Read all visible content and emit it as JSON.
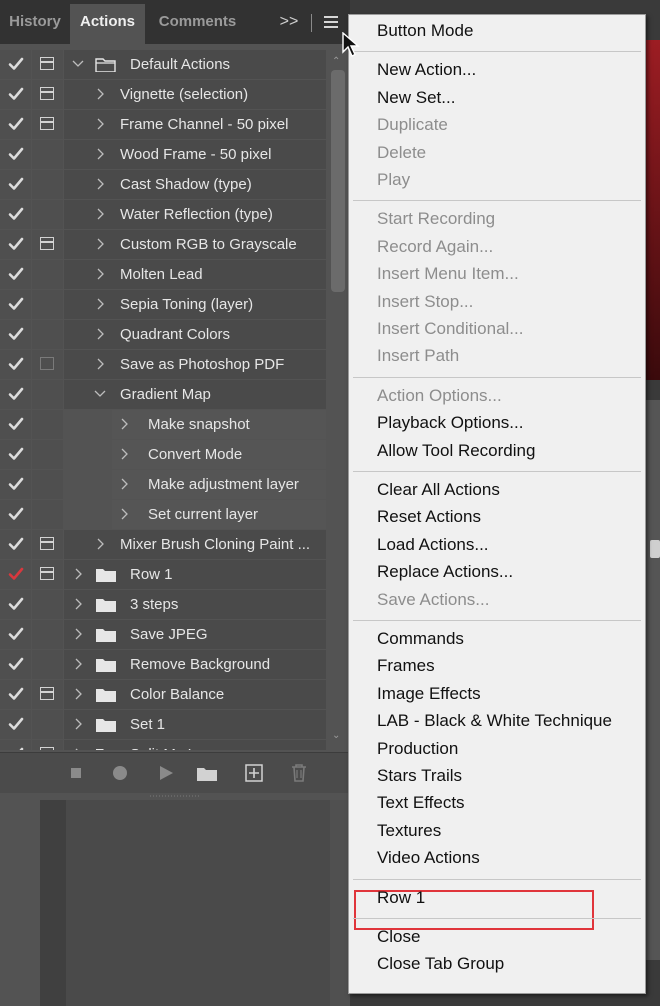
{
  "tabs": [
    {
      "label": "History",
      "active": false
    },
    {
      "label": "Actions",
      "active": true
    },
    {
      "label": "Comments",
      "active": false
    }
  ],
  "rows": [
    {
      "label": "Default Actions",
      "check_color": "#dcdcdc",
      "dialog": "box",
      "chevron": "down",
      "folder": "open",
      "indent": 0
    },
    {
      "label": "Vignette (selection)",
      "check_color": "#dcdcdc",
      "dialog": "box",
      "chevron": "right",
      "folder": "none",
      "indent": 1
    },
    {
      "label": "Frame Channel - 50 pixel",
      "check_color": "#dcdcdc",
      "dialog": "box",
      "chevron": "right",
      "folder": "none",
      "indent": 1
    },
    {
      "label": "Wood Frame - 50 pixel",
      "check_color": "#dcdcdc",
      "dialog": "none",
      "chevron": "right",
      "folder": "none",
      "indent": 1
    },
    {
      "label": "Cast Shadow (type)",
      "check_color": "#dcdcdc",
      "dialog": "none",
      "chevron": "right",
      "folder": "none",
      "indent": 1
    },
    {
      "label": "Water Reflection (type)",
      "check_color": "#dcdcdc",
      "dialog": "none",
      "chevron": "right",
      "folder": "none",
      "indent": 1
    },
    {
      "label": "Custom RGB to Grayscale",
      "check_color": "#dcdcdc",
      "dialog": "box",
      "chevron": "right",
      "folder": "none",
      "indent": 1
    },
    {
      "label": "Molten Lead",
      "check_color": "#dcdcdc",
      "dialog": "none",
      "chevron": "right",
      "folder": "none",
      "indent": 1
    },
    {
      "label": "Sepia Toning (layer)",
      "check_color": "#dcdcdc",
      "dialog": "none",
      "chevron": "right",
      "folder": "none",
      "indent": 1
    },
    {
      "label": "Quadrant Colors",
      "check_color": "#dcdcdc",
      "dialog": "none",
      "chevron": "right",
      "folder": "none",
      "indent": 1
    },
    {
      "label": "Save as Photoshop PDF",
      "check_color": "#dcdcdc",
      "dialog": "box-empty",
      "chevron": "right",
      "folder": "none",
      "indent": 1
    },
    {
      "label": "Gradient Map",
      "check_color": "#dcdcdc",
      "dialog": "none",
      "chevron": "down",
      "folder": "none",
      "indent": 1
    },
    {
      "label": "Make snapshot",
      "check_color": "#dcdcdc",
      "dialog": "none",
      "chevron": "right",
      "folder": "none",
      "indent": 2
    },
    {
      "label": "Convert Mode",
      "check_color": "#dcdcdc",
      "dialog": "none",
      "chevron": "right",
      "folder": "none",
      "indent": 2
    },
    {
      "label": "Make adjustment layer",
      "check_color": "#dcdcdc",
      "dialog": "none",
      "chevron": "right",
      "folder": "none",
      "indent": 2
    },
    {
      "label": "Set current layer",
      "check_color": "#dcdcdc",
      "dialog": "none",
      "chevron": "right",
      "folder": "none",
      "indent": 2
    },
    {
      "label": "Mixer Brush Cloning Paint ...",
      "check_color": "#dcdcdc",
      "dialog": "box",
      "chevron": "right",
      "folder": "none",
      "indent": 1
    },
    {
      "label": "Row 1",
      "check_color": "#d8383e",
      "dialog": "box",
      "chevron": "right",
      "folder": "closed",
      "indent": 0
    },
    {
      "label": "3 steps",
      "check_color": "#dcdcdc",
      "dialog": "none",
      "chevron": "right",
      "folder": "closed",
      "indent": 0
    },
    {
      "label": "Save JPEG",
      "check_color": "#dcdcdc",
      "dialog": "none",
      "chevron": "right",
      "folder": "closed",
      "indent": 0
    },
    {
      "label": "Remove Background",
      "check_color": "#dcdcdc",
      "dialog": "none",
      "chevron": "right",
      "folder": "closed",
      "indent": 0
    },
    {
      "label": "Color Balance",
      "check_color": "#dcdcdc",
      "dialog": "box",
      "chevron": "right",
      "folder": "closed",
      "indent": 0
    },
    {
      "label": "Set 1",
      "check_color": "#dcdcdc",
      "dialog": "none",
      "chevron": "right",
      "folder": "closed",
      "indent": 0
    },
    {
      "label": "Split My I...",
      "check_color": "#dcdcdc",
      "dialog": "box",
      "chevron": "right",
      "folder": "closed",
      "indent": 0
    }
  ],
  "bottom_icons": [
    "stop-icon",
    "record-icon",
    "play-icon",
    "new-set-icon",
    "new-action-icon",
    "trash-icon"
  ],
  "menu_groups": [
    [
      {
        "label": "Button Mode",
        "enabled": true
      }
    ],
    [
      {
        "label": "New Action...",
        "enabled": true
      },
      {
        "label": "New Set...",
        "enabled": true
      },
      {
        "label": "Duplicate",
        "enabled": false
      },
      {
        "label": "Delete",
        "enabled": false
      },
      {
        "label": "Play",
        "enabled": false
      }
    ],
    [
      {
        "label": "Start Recording",
        "enabled": false
      },
      {
        "label": "Record Again...",
        "enabled": false
      },
      {
        "label": "Insert Menu Item...",
        "enabled": false
      },
      {
        "label": "Insert Stop...",
        "enabled": false
      },
      {
        "label": "Insert Conditional...",
        "enabled": false
      },
      {
        "label": "Insert Path",
        "enabled": false
      }
    ],
    [
      {
        "label": "Action Options...",
        "enabled": false
      },
      {
        "label": "Playback Options...",
        "enabled": true
      },
      {
        "label": "Allow Tool Recording",
        "enabled": true
      }
    ],
    [
      {
        "label": "Clear All Actions",
        "enabled": true
      },
      {
        "label": "Reset Actions",
        "enabled": true
      },
      {
        "label": "Load Actions...",
        "enabled": true
      },
      {
        "label": "Replace Actions...",
        "enabled": true
      },
      {
        "label": "Save Actions...",
        "enabled": false
      }
    ],
    [
      {
        "label": "Commands",
        "enabled": true
      },
      {
        "label": "Frames",
        "enabled": true
      },
      {
        "label": "Image Effects",
        "enabled": true
      },
      {
        "label": "LAB - Black & White Technique",
        "enabled": true
      },
      {
        "label": "Production",
        "enabled": true
      },
      {
        "label": "Stars Trails",
        "enabled": true
      },
      {
        "label": "Text Effects",
        "enabled": true
      },
      {
        "label": "Textures",
        "enabled": true
      },
      {
        "label": "Video Actions",
        "enabled": true
      }
    ],
    [
      {
        "label": "Row 1",
        "enabled": true
      }
    ],
    [
      {
        "label": "Close",
        "enabled": true
      },
      {
        "label": "Close Tab Group",
        "enabled": true
      }
    ]
  ],
  "highlighted_menu_item": "Row 1",
  "colors": {
    "highlight": "#e0353b",
    "panel": "#535353",
    "menu_bg": "#f0f0f0"
  }
}
